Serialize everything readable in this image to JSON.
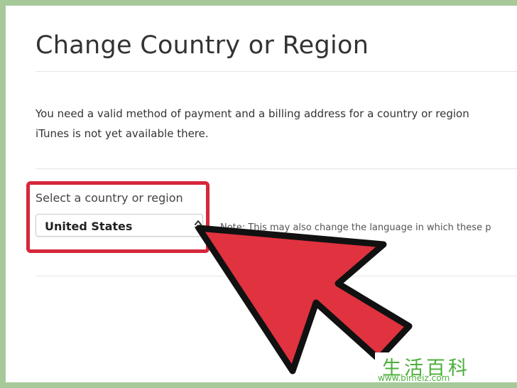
{
  "page": {
    "title": "Change Country or Region",
    "description_line1": "You need a valid method of payment and a billing address for a country or region",
    "description_line2": "iTunes is not yet available there."
  },
  "country_selector": {
    "label": "Select a country or region",
    "selected_value": "United States",
    "note": "Note: This may also change the language in which these p"
  },
  "overlay": {
    "arrow_icon": "big-red-arrow-icon",
    "highlight_color": "#d6273b",
    "arrow_color": "#e0323f"
  },
  "watermark": {
    "logo_text": "生活百科",
    "url": "www.bimeiz.com"
  }
}
